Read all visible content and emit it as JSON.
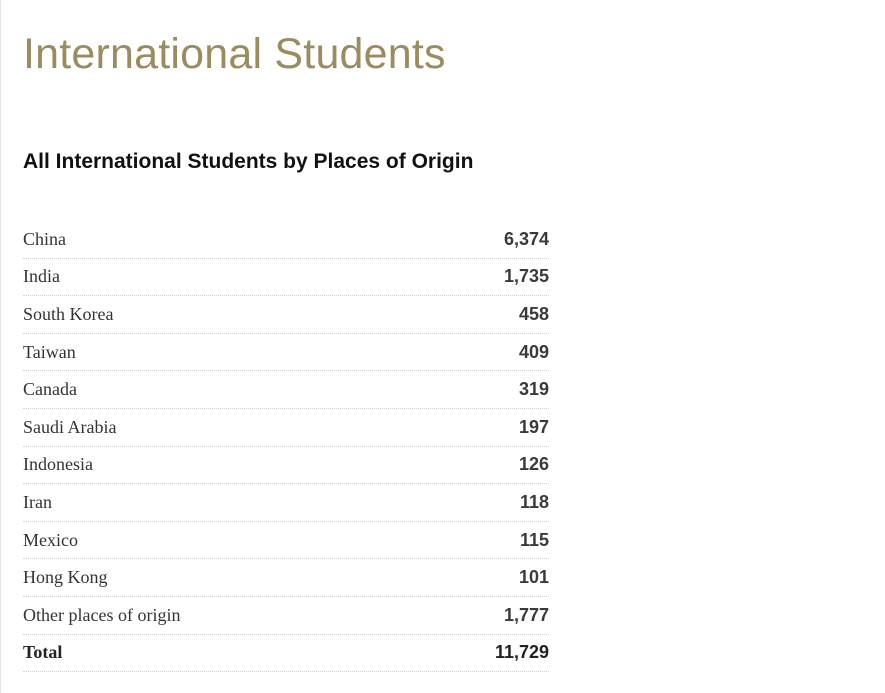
{
  "page": {
    "title": "International Students"
  },
  "section": {
    "title": "All International Students by Places of Origin"
  },
  "table": {
    "rows": [
      {
        "place": "China",
        "count": "6,374"
      },
      {
        "place": "India",
        "count": "1,735"
      },
      {
        "place": "South Korea",
        "count": "458"
      },
      {
        "place": "Taiwan",
        "count": "409"
      },
      {
        "place": "Canada",
        "count": "319"
      },
      {
        "place": "Saudi Arabia",
        "count": "197"
      },
      {
        "place": "Indonesia",
        "count": "126"
      },
      {
        "place": "Iran",
        "count": "118"
      },
      {
        "place": "Mexico",
        "count": "115"
      },
      {
        "place": "Hong Kong",
        "count": "101"
      },
      {
        "place": "Other places of origin",
        "count": "1,777"
      }
    ],
    "total": {
      "place": "Total",
      "count": "11,729"
    }
  },
  "colors": {
    "title": "#9a8c5f",
    "heading": "#111111",
    "divider": "#cfcfcf"
  }
}
